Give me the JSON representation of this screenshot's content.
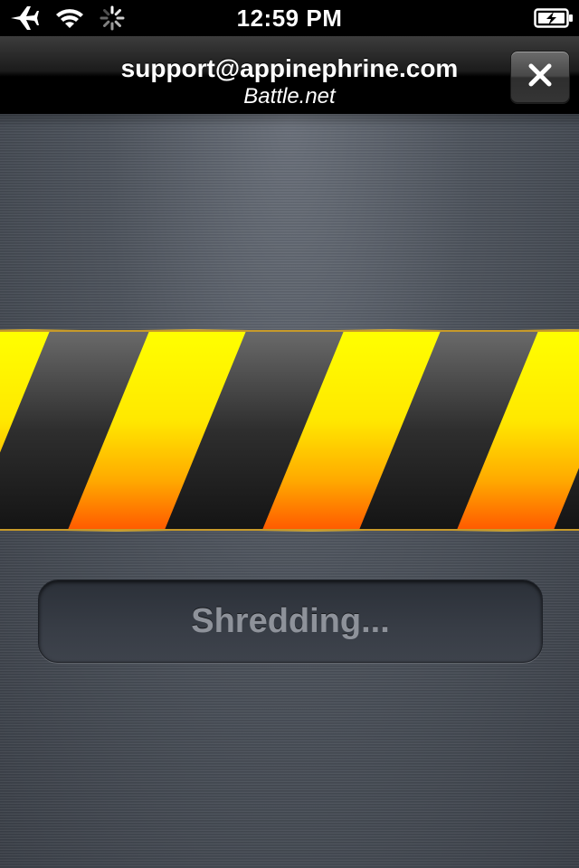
{
  "status_bar": {
    "time": "12:59 PM",
    "icons": [
      "airplane-icon",
      "wifi-icon",
      "activity-spinner-icon",
      "battery-charging-icon"
    ]
  },
  "header": {
    "title": "support@appinephrine.com",
    "subtitle": "Battle.net",
    "close_icon": "close-x-icon"
  },
  "hazard": {
    "colors": {
      "yellow": "#ffff00",
      "orange": "#ff6a00",
      "dark": "#2a2a2a"
    }
  },
  "status_field": {
    "text": "Shredding..."
  }
}
